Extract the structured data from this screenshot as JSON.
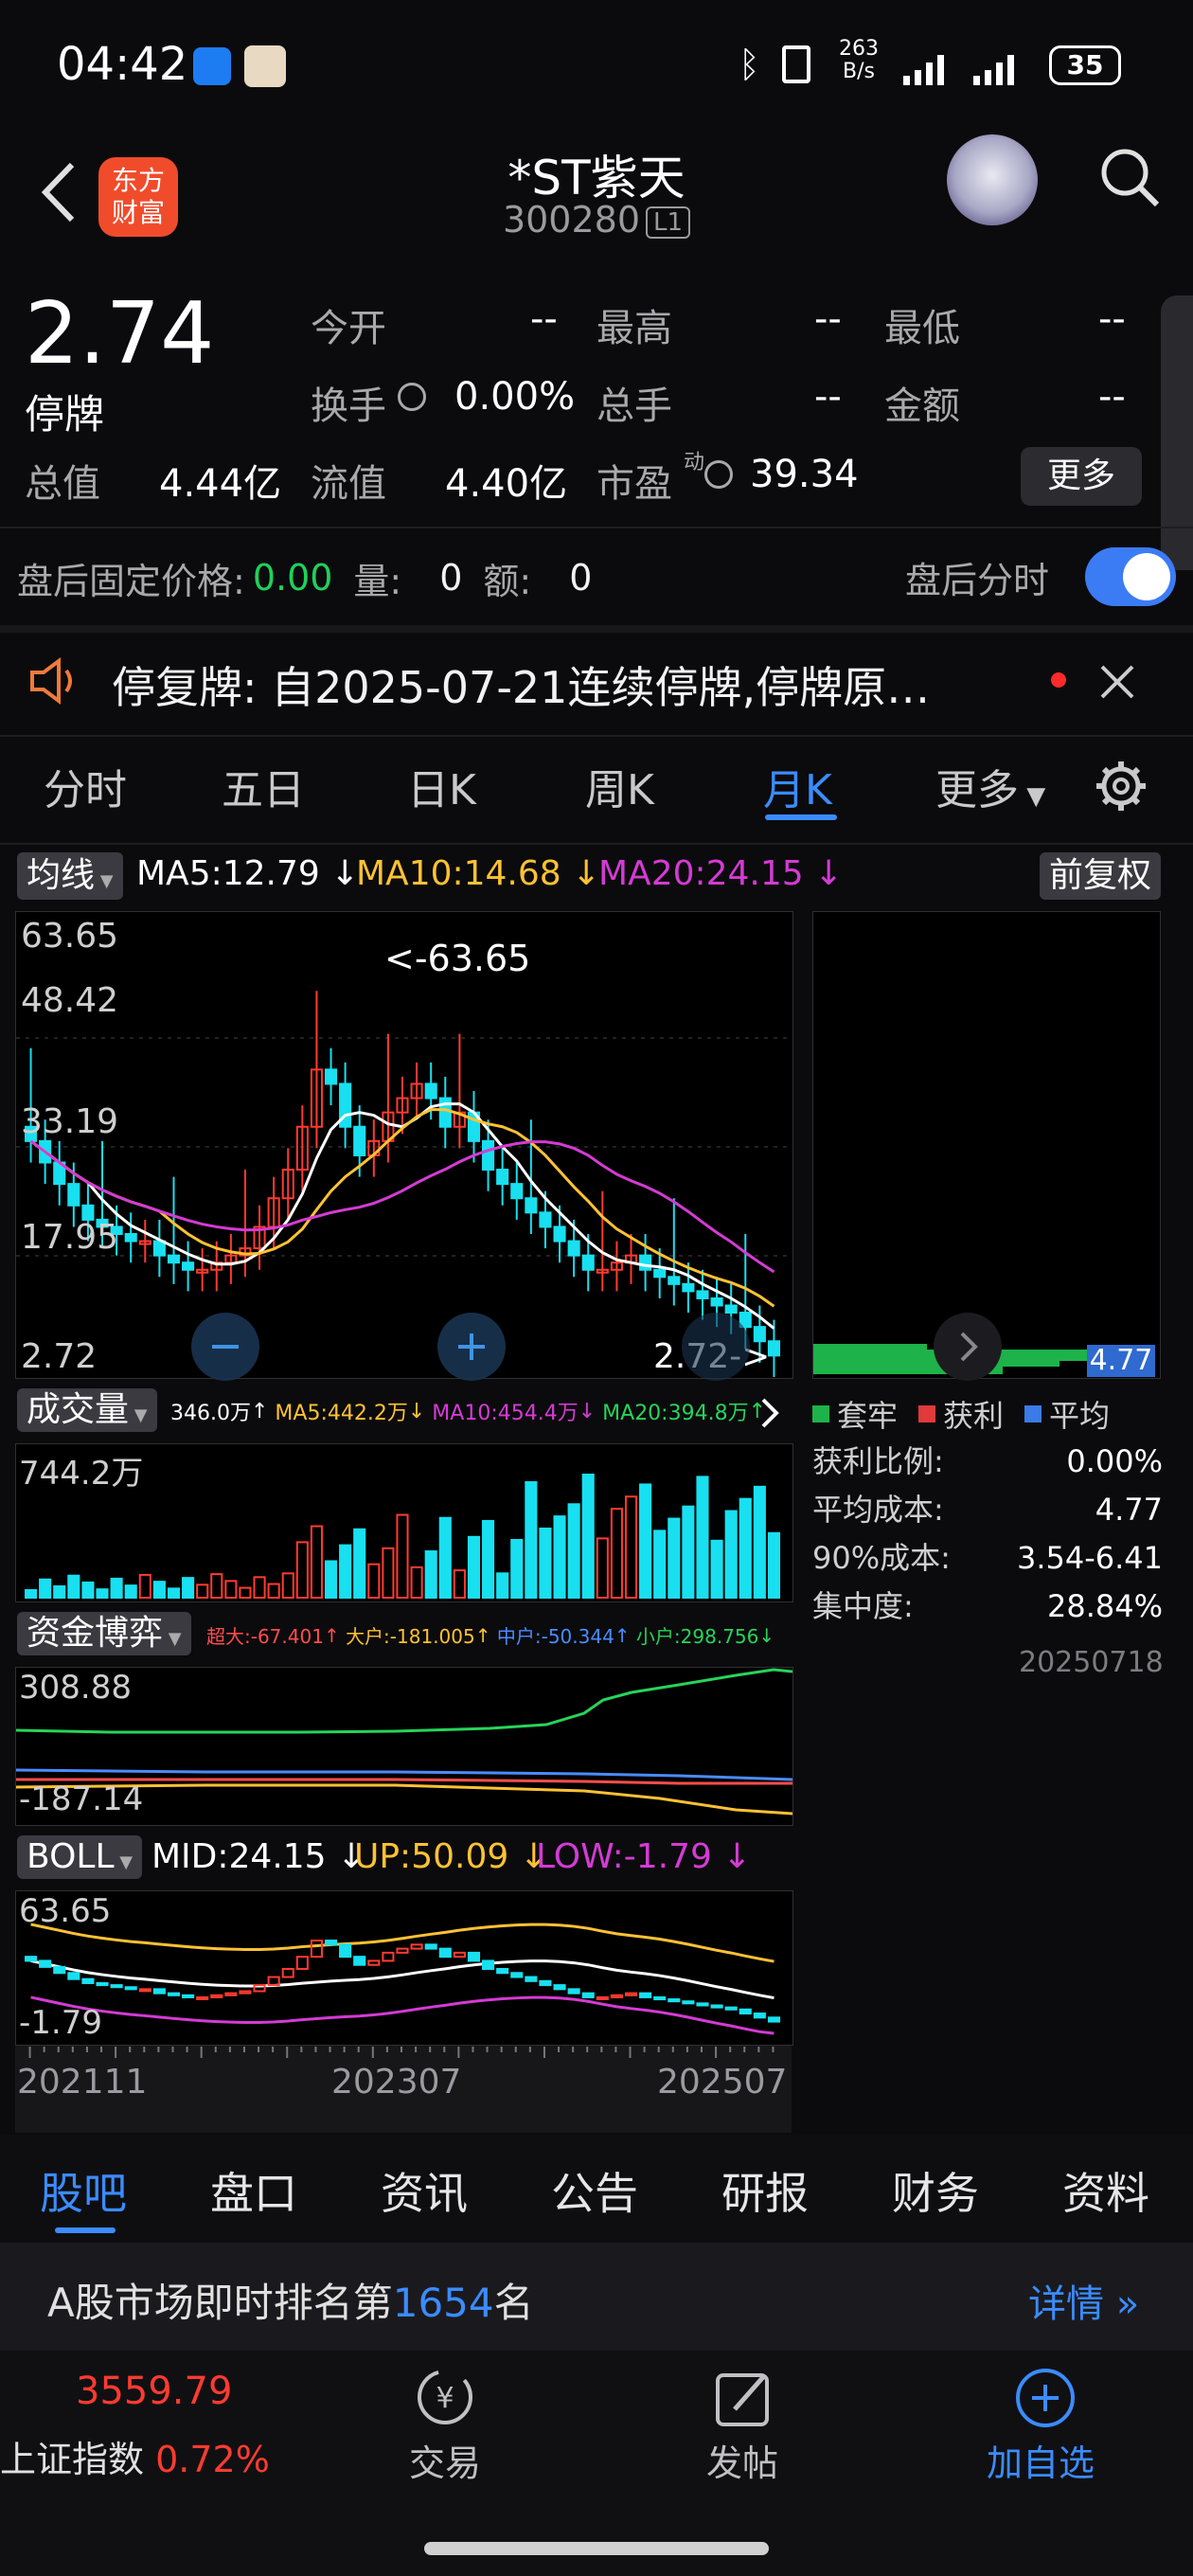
{
  "status_bar": {
    "time": "04:42",
    "net_speed_top": "263",
    "net_speed_bottom": "B/s",
    "battery": "35"
  },
  "header": {
    "logo_line1": "东方",
    "logo_line2": "财富",
    "name": "*ST紫天",
    "code": "300280",
    "level": "L1"
  },
  "quote": {
    "price": "2.74",
    "status": "停牌",
    "open_label": "今开",
    "open_value": "--",
    "high_label": "最高",
    "high_value": "--",
    "low_label": "最低",
    "low_value": "--",
    "turnover_label": "换手",
    "turnover_value": "0.00%",
    "volume_label": "总手",
    "volume_value": "--",
    "amount_label": "金额",
    "amount_value": "--",
    "mcap_label": "总值",
    "mcap_value": "4.44亿",
    "float_label": "流值",
    "float_value": "4.40亿",
    "pe_label": "市盈",
    "pe_sup": "动",
    "pe_value": "39.34",
    "more": "更多"
  },
  "after_hours": {
    "price_label": "盘后固定价格:",
    "price_value": "0.00",
    "qty_label": "量:",
    "qty_value": "0",
    "amt_label": "额:",
    "amt_value": "0",
    "toggle_label": "盘后分时"
  },
  "notice": {
    "text": "停复牌: 自2025-07-21连续停牌,停牌原…"
  },
  "tabs": [
    "分时",
    "五日",
    "日K",
    "周K",
    "月K",
    "更多"
  ],
  "active_tab": "月K",
  "ma_bar": {
    "selector": "均线",
    "ma5": "MA5:12.79",
    "ma10": "MA10:14.68",
    "ma20": "MA20:24.15",
    "adjust": "前复权"
  },
  "kline": {
    "y_labels": [
      "63.65",
      "48.42",
      "33.19",
      "17.95",
      "2.72"
    ],
    "high_annot": "<-63.65",
    "low_annot": "2.72->",
    "cost_value": "4.77"
  },
  "volume_bar": {
    "selector": "成交量",
    "vol": "346.0万",
    "ma5": "MA5:442.2万",
    "ma10": "MA10:454.4万",
    "ma20": "MA20:394.8万",
    "y_max": "744.2万"
  },
  "chip_dist": {
    "legend": [
      "套牢",
      "获利",
      "平均"
    ],
    "rows": [
      {
        "label": "获利比例:",
        "value": "0.00%"
      },
      {
        "label": "平均成本:",
        "value": "4.77"
      },
      {
        "label": "90%成本:",
        "value": "3.54-6.41"
      },
      {
        "label": "集中度:",
        "value": "28.84%"
      }
    ],
    "date": "20250718"
  },
  "fund_bar": {
    "selector": "资金博弈",
    "super": "超大:-67.401",
    "big": "大户:-181.005",
    "mid": "中户:-50.344",
    "small": "小户:298.756",
    "y_top": "308.88",
    "y_bottom": "-187.14"
  },
  "boll_bar": {
    "selector": "BOLL",
    "mid": "MID:24.15",
    "up": "UP:50.09",
    "low": "LOW:-1.79",
    "y_top": "63.65",
    "y_bottom": "-1.79"
  },
  "x_axis": [
    "202111",
    "202307",
    "202507"
  ],
  "bottom_tabs": [
    "股吧",
    "盘口",
    "资讯",
    "公告",
    "研报",
    "财务",
    "资料"
  ],
  "rank": {
    "prefix": "A股市场即时排名第",
    "number": "1654",
    "suffix": "名",
    "detail": "详情"
  },
  "bottom_nav": {
    "index_value": "3559.79",
    "index_name": "上证指数",
    "index_change": "0.72%",
    "trade": "交易",
    "post": "发帖",
    "add": "加自选"
  },
  "colors": {
    "accent": "#3b8cff",
    "up": "#ff3b30",
    "down": "#18e0f0",
    "ma5": "#ffffff",
    "ma10": "#ffc233",
    "ma20": "#d43bd4"
  }
}
